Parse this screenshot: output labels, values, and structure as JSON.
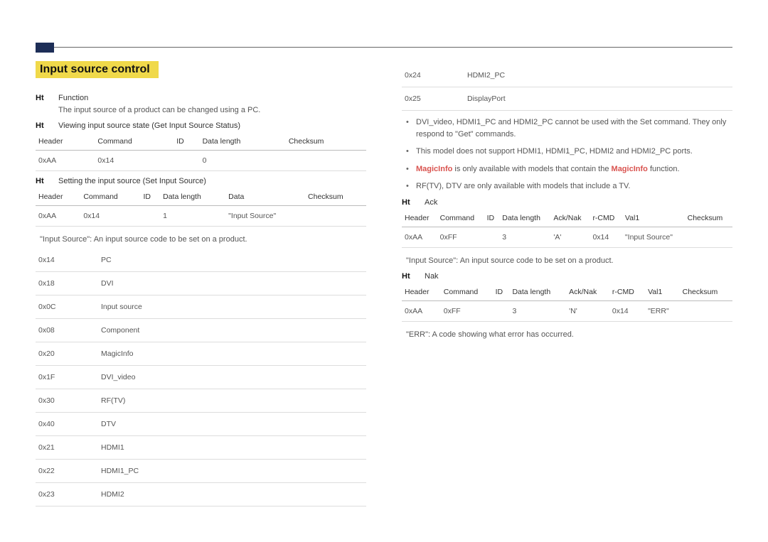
{
  "section_title": "Input source control",
  "left": {
    "function_label": "Function",
    "function_desc": "The input source of a product can be changed using a PC.",
    "view_label": "Viewing input source state (Get Input Source Status)",
    "view_table": {
      "headers": [
        "Header",
        "Command",
        "ID",
        "Data length",
        "Checksum"
      ],
      "row": [
        "0xAA",
        "0x14",
        "",
        "0",
        ""
      ]
    },
    "set_label": "Setting the input source (Set Input Source)",
    "set_table": {
      "headers": [
        "Header",
        "Command",
        "ID",
        "Data length",
        "Data",
        "Checksum"
      ],
      "row": [
        "0xAA",
        "0x14",
        "",
        "1",
        "\"Input Source\"",
        ""
      ]
    },
    "note": "\"Input Source\": An input source code to be set on a product.",
    "codes": [
      {
        "code": "0x14",
        "name": "PC"
      },
      {
        "code": "0x18",
        "name": "DVI"
      },
      {
        "code": "0x0C",
        "name": "Input source"
      },
      {
        "code": "0x08",
        "name": "Component"
      },
      {
        "code": "0x20",
        "name": "MagicInfo"
      },
      {
        "code": "0x1F",
        "name": "DVI_video"
      },
      {
        "code": "0x30",
        "name": "RF(TV)"
      },
      {
        "code": "0x40",
        "name": "DTV"
      },
      {
        "code": "0x21",
        "name": "HDMI1"
      },
      {
        "code": "0x22",
        "name": "HDMI1_PC"
      },
      {
        "code": "0x23",
        "name": "HDMI2"
      }
    ]
  },
  "right": {
    "codes_cont": [
      {
        "code": "0x24",
        "name": "HDMI2_PC"
      },
      {
        "code": "0x25",
        "name": "DisplayPort"
      }
    ],
    "notes": [
      "DVI_video, HDMI1_PC and HDMI2_PC cannot be used with the Set command. They only respond to \"Get\" commands.",
      "This model does not support HDMI1, HDMI1_PC, HDMI2 and HDMI2_PC ports.",
      "MagicInfo is only available with models that contain the MagicInfo function.",
      "RF(TV), DTV are only available with models that include a TV."
    ],
    "ack_label": "Ack",
    "ack_table": {
      "headers": [
        "Header",
        "Command",
        "ID",
        "Data length",
        "Ack/Nak",
        "r-CMD",
        "Val1",
        "Checksum"
      ],
      "row": [
        "0xAA",
        "0xFF",
        "",
        "3",
        "'A'",
        "0x14",
        "\"Input Source\"",
        ""
      ]
    },
    "ack_note": "\"Input Source\": An input source code to be set on a product.",
    "nak_label": "Nak",
    "nak_table": {
      "headers": [
        "Header",
        "Command",
        "ID",
        "Data length",
        "Ack/Nak",
        "r-CMD",
        "Val1",
        "Checksum"
      ],
      "row": [
        "0xAA",
        "0xFF",
        "",
        "3",
        "'N'",
        "0x14",
        "\"ERR\"",
        ""
      ]
    },
    "nak_note": "\"ERR\": A code showing what error has occurred."
  }
}
